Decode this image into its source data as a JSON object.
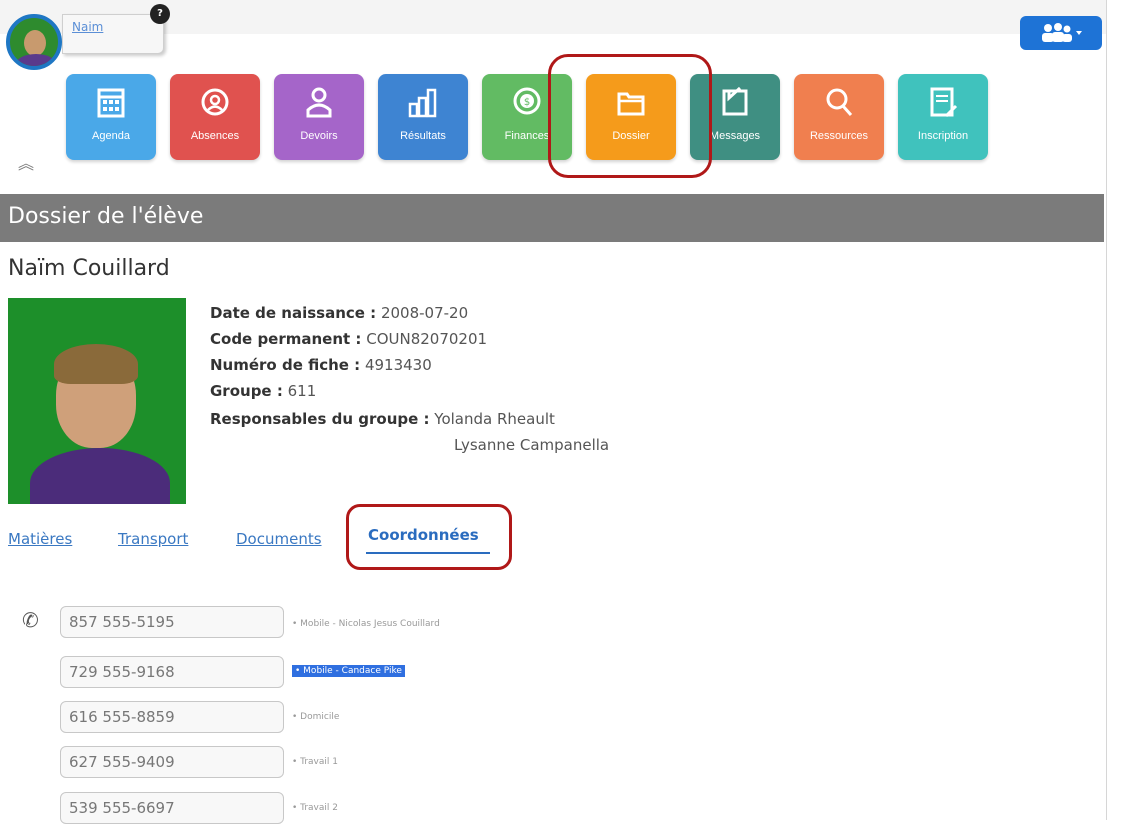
{
  "user": {
    "name": "Naim",
    "badge": "?"
  },
  "nav_tiles": [
    {
      "label": "Agenda",
      "icon": "calendar-icon",
      "color": "#4aa8e8"
    },
    {
      "label": "Absences",
      "icon": "alarm-icon",
      "color": "#e0524f"
    },
    {
      "label": "Devoirs",
      "icon": "student-icon",
      "color": "#a565c9"
    },
    {
      "label": "Résultats",
      "icon": "bar-chart-icon",
      "color": "#3e84d2"
    },
    {
      "label": "Finances",
      "icon": "coin-icon",
      "color": "#62bb63"
    },
    {
      "label": "Dossier",
      "icon": "folder-icon",
      "color": "#f59b1b"
    },
    {
      "label": "Messages",
      "icon": "message-icon",
      "color": "#3f8f82"
    },
    {
      "label": "Ressources",
      "icon": "search-doc-icon",
      "color": "#f07f4f"
    },
    {
      "label": "Inscription",
      "icon": "form-icon",
      "color": "#40c2bd"
    }
  ],
  "page_title": "Dossier de l'élève",
  "student": {
    "name": "Naïm Couillard",
    "fields": [
      {
        "label": "Date de naissance :",
        "value": "2008-07-20"
      },
      {
        "label": "Code permanent :",
        "value": "COUN82070201"
      },
      {
        "label": "Numéro de fiche :",
        "value": "4913430"
      },
      {
        "label": "Groupe :",
        "value": "611"
      },
      {
        "label": "Responsables du groupe :",
        "value": "Yolanda Rheault"
      }
    ],
    "second_responsible": "Lysanne Campanella"
  },
  "tabs": [
    "Matières",
    "Transport",
    "Documents",
    "Coordonnées"
  ],
  "phones": [
    {
      "number": "857 555-5195",
      "desc": "• Mobile - Nicolas Jesus Couillard"
    },
    {
      "number": "729 555-9168",
      "desc": "• Mobile - Candace Pike"
    },
    {
      "number": "616 555-8859",
      "desc": "• Domicile"
    },
    {
      "number": "627 555-9409",
      "desc": "• Travail 1"
    },
    {
      "number": "539 555-6697",
      "desc": "• Travail 2"
    }
  ]
}
